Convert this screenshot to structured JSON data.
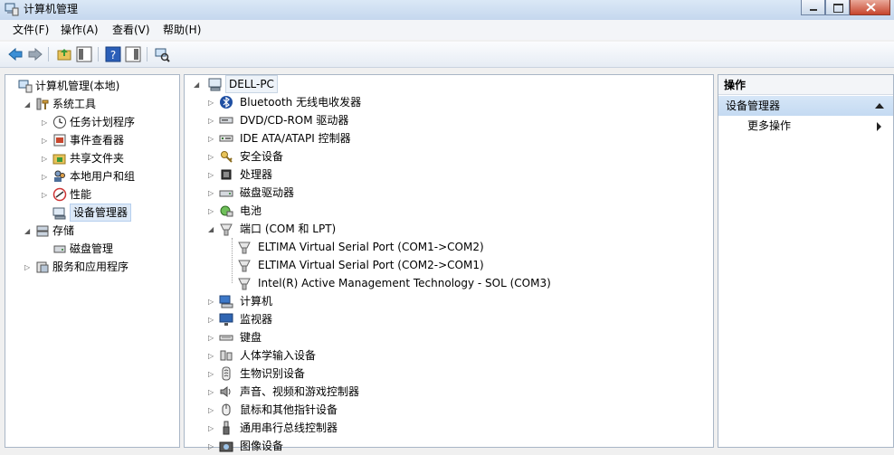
{
  "window": {
    "title": "计算机管理"
  },
  "menu": [
    "文件(F)",
    "操作(A)",
    "查看(V)",
    "帮助(H)"
  ],
  "left_tree": [
    {
      "label": "计算机管理(本地)",
      "icon": "computer-management-icon",
      "level": 0,
      "expander": "",
      "selected": false
    },
    {
      "label": "系统工具",
      "icon": "system-tools-icon",
      "level": 1,
      "expander": "open",
      "selected": false
    },
    {
      "label": "任务计划程序",
      "icon": "clock-icon",
      "level": 2,
      "expander": "closed",
      "selected": false
    },
    {
      "label": "事件查看器",
      "icon": "event-viewer-icon",
      "level": 2,
      "expander": "closed",
      "selected": false
    },
    {
      "label": "共享文件夹",
      "icon": "shared-folder-icon",
      "level": 2,
      "expander": "closed",
      "selected": false
    },
    {
      "label": "本地用户和组",
      "icon": "users-icon",
      "level": 2,
      "expander": "closed",
      "selected": false
    },
    {
      "label": "性能",
      "icon": "performance-icon",
      "level": 2,
      "expander": "closed",
      "selected": false
    },
    {
      "label": "设备管理器",
      "icon": "device-manager-icon",
      "level": 2,
      "expander": "",
      "selected": true
    },
    {
      "label": "存储",
      "icon": "storage-icon",
      "level": 1,
      "expander": "open",
      "selected": false
    },
    {
      "label": "磁盘管理",
      "icon": "disk-management-icon",
      "level": 2,
      "expander": "",
      "selected": false
    },
    {
      "label": "服务和应用程序",
      "icon": "services-icon",
      "level": 1,
      "expander": "closed",
      "selected": false
    }
  ],
  "device_tree": {
    "root": "DELL-PC",
    "items": [
      {
        "label": "Bluetooth 无线电收发器",
        "icon": "bluetooth-icon",
        "level": 1,
        "expander": "closed"
      },
      {
        "label": "DVD/CD-ROM 驱动器",
        "icon": "dvd-drive-icon",
        "level": 1,
        "expander": "closed"
      },
      {
        "label": "IDE ATA/ATAPI 控制器",
        "icon": "ide-controller-icon",
        "level": 1,
        "expander": "closed"
      },
      {
        "label": "安全设备",
        "icon": "security-key-icon",
        "level": 1,
        "expander": "closed"
      },
      {
        "label": "处理器",
        "icon": "processor-icon",
        "level": 1,
        "expander": "closed"
      },
      {
        "label": "磁盘驱动器",
        "icon": "disk-drive-icon",
        "level": 1,
        "expander": "closed"
      },
      {
        "label": "电池",
        "icon": "battery-icon",
        "level": 1,
        "expander": "closed"
      },
      {
        "label": "端口 (COM 和 LPT)",
        "icon": "port-icon",
        "level": 1,
        "expander": "open"
      },
      {
        "label": "ELTIMA Virtual Serial Port (COM1->COM2)",
        "icon": "port-icon",
        "level": 2,
        "expander": ""
      },
      {
        "label": "ELTIMA Virtual Serial Port (COM2->COM1)",
        "icon": "port-icon",
        "level": 2,
        "expander": ""
      },
      {
        "label": "Intel(R) Active Management Technology - SOL (COM3)",
        "icon": "port-icon",
        "level": 2,
        "expander": ""
      },
      {
        "label": "计算机",
        "icon": "computer-icon",
        "level": 1,
        "expander": "closed"
      },
      {
        "label": "监视器",
        "icon": "monitor-icon",
        "level": 1,
        "expander": "closed"
      },
      {
        "label": "键盘",
        "icon": "keyboard-icon",
        "level": 1,
        "expander": "closed"
      },
      {
        "label": "人体学输入设备",
        "icon": "hid-icon",
        "level": 1,
        "expander": "closed"
      },
      {
        "label": "生物识别设备",
        "icon": "biometric-icon",
        "level": 1,
        "expander": "closed"
      },
      {
        "label": "声音、视频和游戏控制器",
        "icon": "sound-icon",
        "level": 1,
        "expander": "closed"
      },
      {
        "label": "鼠标和其他指针设备",
        "icon": "mouse-icon",
        "level": 1,
        "expander": "closed"
      },
      {
        "label": "通用串行总线控制器",
        "icon": "usb-icon",
        "level": 1,
        "expander": "closed"
      },
      {
        "label": "图像设备",
        "icon": "imaging-icon",
        "level": 1,
        "expander": "closed"
      }
    ]
  },
  "actions": {
    "title": "操作",
    "group": "设备管理器",
    "more": "更多操作"
  }
}
